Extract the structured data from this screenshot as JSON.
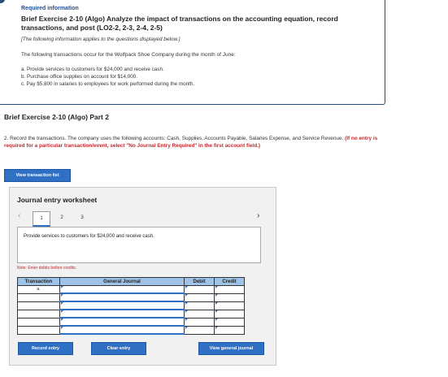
{
  "header": {
    "required_label": "Required information",
    "title": "Brief Exercise 2-10 (Algo) Analyze the impact of transactions on the accounting equation, record transactions, and post (LO2-2, 2-3, 2-4, 2-5)",
    "note": "[The following information applies to the questions displayed below.]",
    "intro": "The following transactions occur for the Wolfpack Shoe Company during the month of June:",
    "transactions": [
      "a. Provide services to customers for $24,000 and receive cash.",
      "b. Purchase office supplies on account for $14,000.",
      "c. Pay $5,800 in salaries to employees for work performed during the month."
    ]
  },
  "part": {
    "title": "Brief Exercise 2-10 (Algo) Part 2",
    "instruction": "2. Record the transactions. The company uses the following accounts: Cash, Supplies, Accounts Payable, Salaries Expense, and Service Revenue.",
    "instruction_red": "(If no entry is required for a particular transaction/event, select \"No Journal Entry Required\" in the first account field.)"
  },
  "buttons": {
    "view_list": "View transaction list",
    "record": "Record entry",
    "clear": "Clear entry",
    "view_journal": "View general journal"
  },
  "worksheet": {
    "title": "Journal entry worksheet",
    "pages": [
      "1",
      "2",
      "3"
    ],
    "active_page": "1",
    "description": "Provide services to customers for $24,000 and receive cash.",
    "debit_note": "Note: Enter debits before credits.",
    "columns": [
      "Transaction",
      "General Journal",
      "Debit",
      "Credit"
    ],
    "rows": [
      {
        "transaction": "a."
      },
      {
        "transaction": ""
      },
      {
        "transaction": ""
      },
      {
        "transaction": ""
      },
      {
        "transaction": ""
      },
      {
        "transaction": ""
      }
    ]
  },
  "colors": {
    "accent": "#2f6fc4",
    "header_blue": "#9fc2e7",
    "warning_red": "#c0282e"
  }
}
